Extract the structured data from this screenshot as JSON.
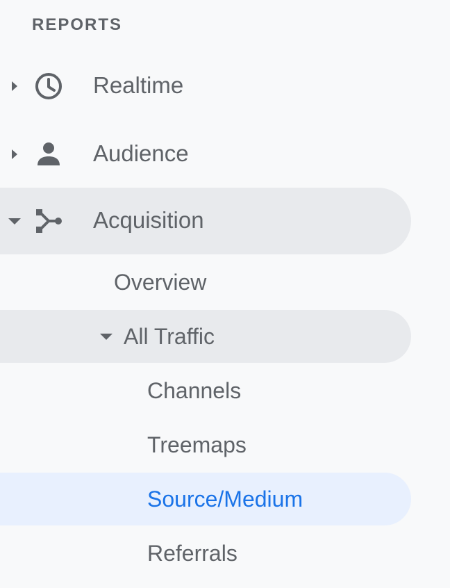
{
  "sidebar": {
    "section_title": "REPORTS",
    "items": [
      {
        "label": "Realtime",
        "icon": "clock-icon",
        "expanded": false
      },
      {
        "label": "Audience",
        "icon": "person-icon",
        "expanded": false
      },
      {
        "label": "Acquisition",
        "icon": "acquisition-icon",
        "expanded": true,
        "children": [
          {
            "label": "Overview"
          },
          {
            "label": "All Traffic",
            "expanded": true,
            "children": [
              {
                "label": "Channels"
              },
              {
                "label": "Treemaps"
              },
              {
                "label": "Source/Medium",
                "selected": true
              },
              {
                "label": "Referrals"
              }
            ]
          }
        ]
      }
    ]
  },
  "colors": {
    "background": "#f8f9fa",
    "text": "#5f6368",
    "expanded_bg": "#e8eaed",
    "selected_bg": "#e8f0fe",
    "selected_text": "#1a73e8"
  }
}
